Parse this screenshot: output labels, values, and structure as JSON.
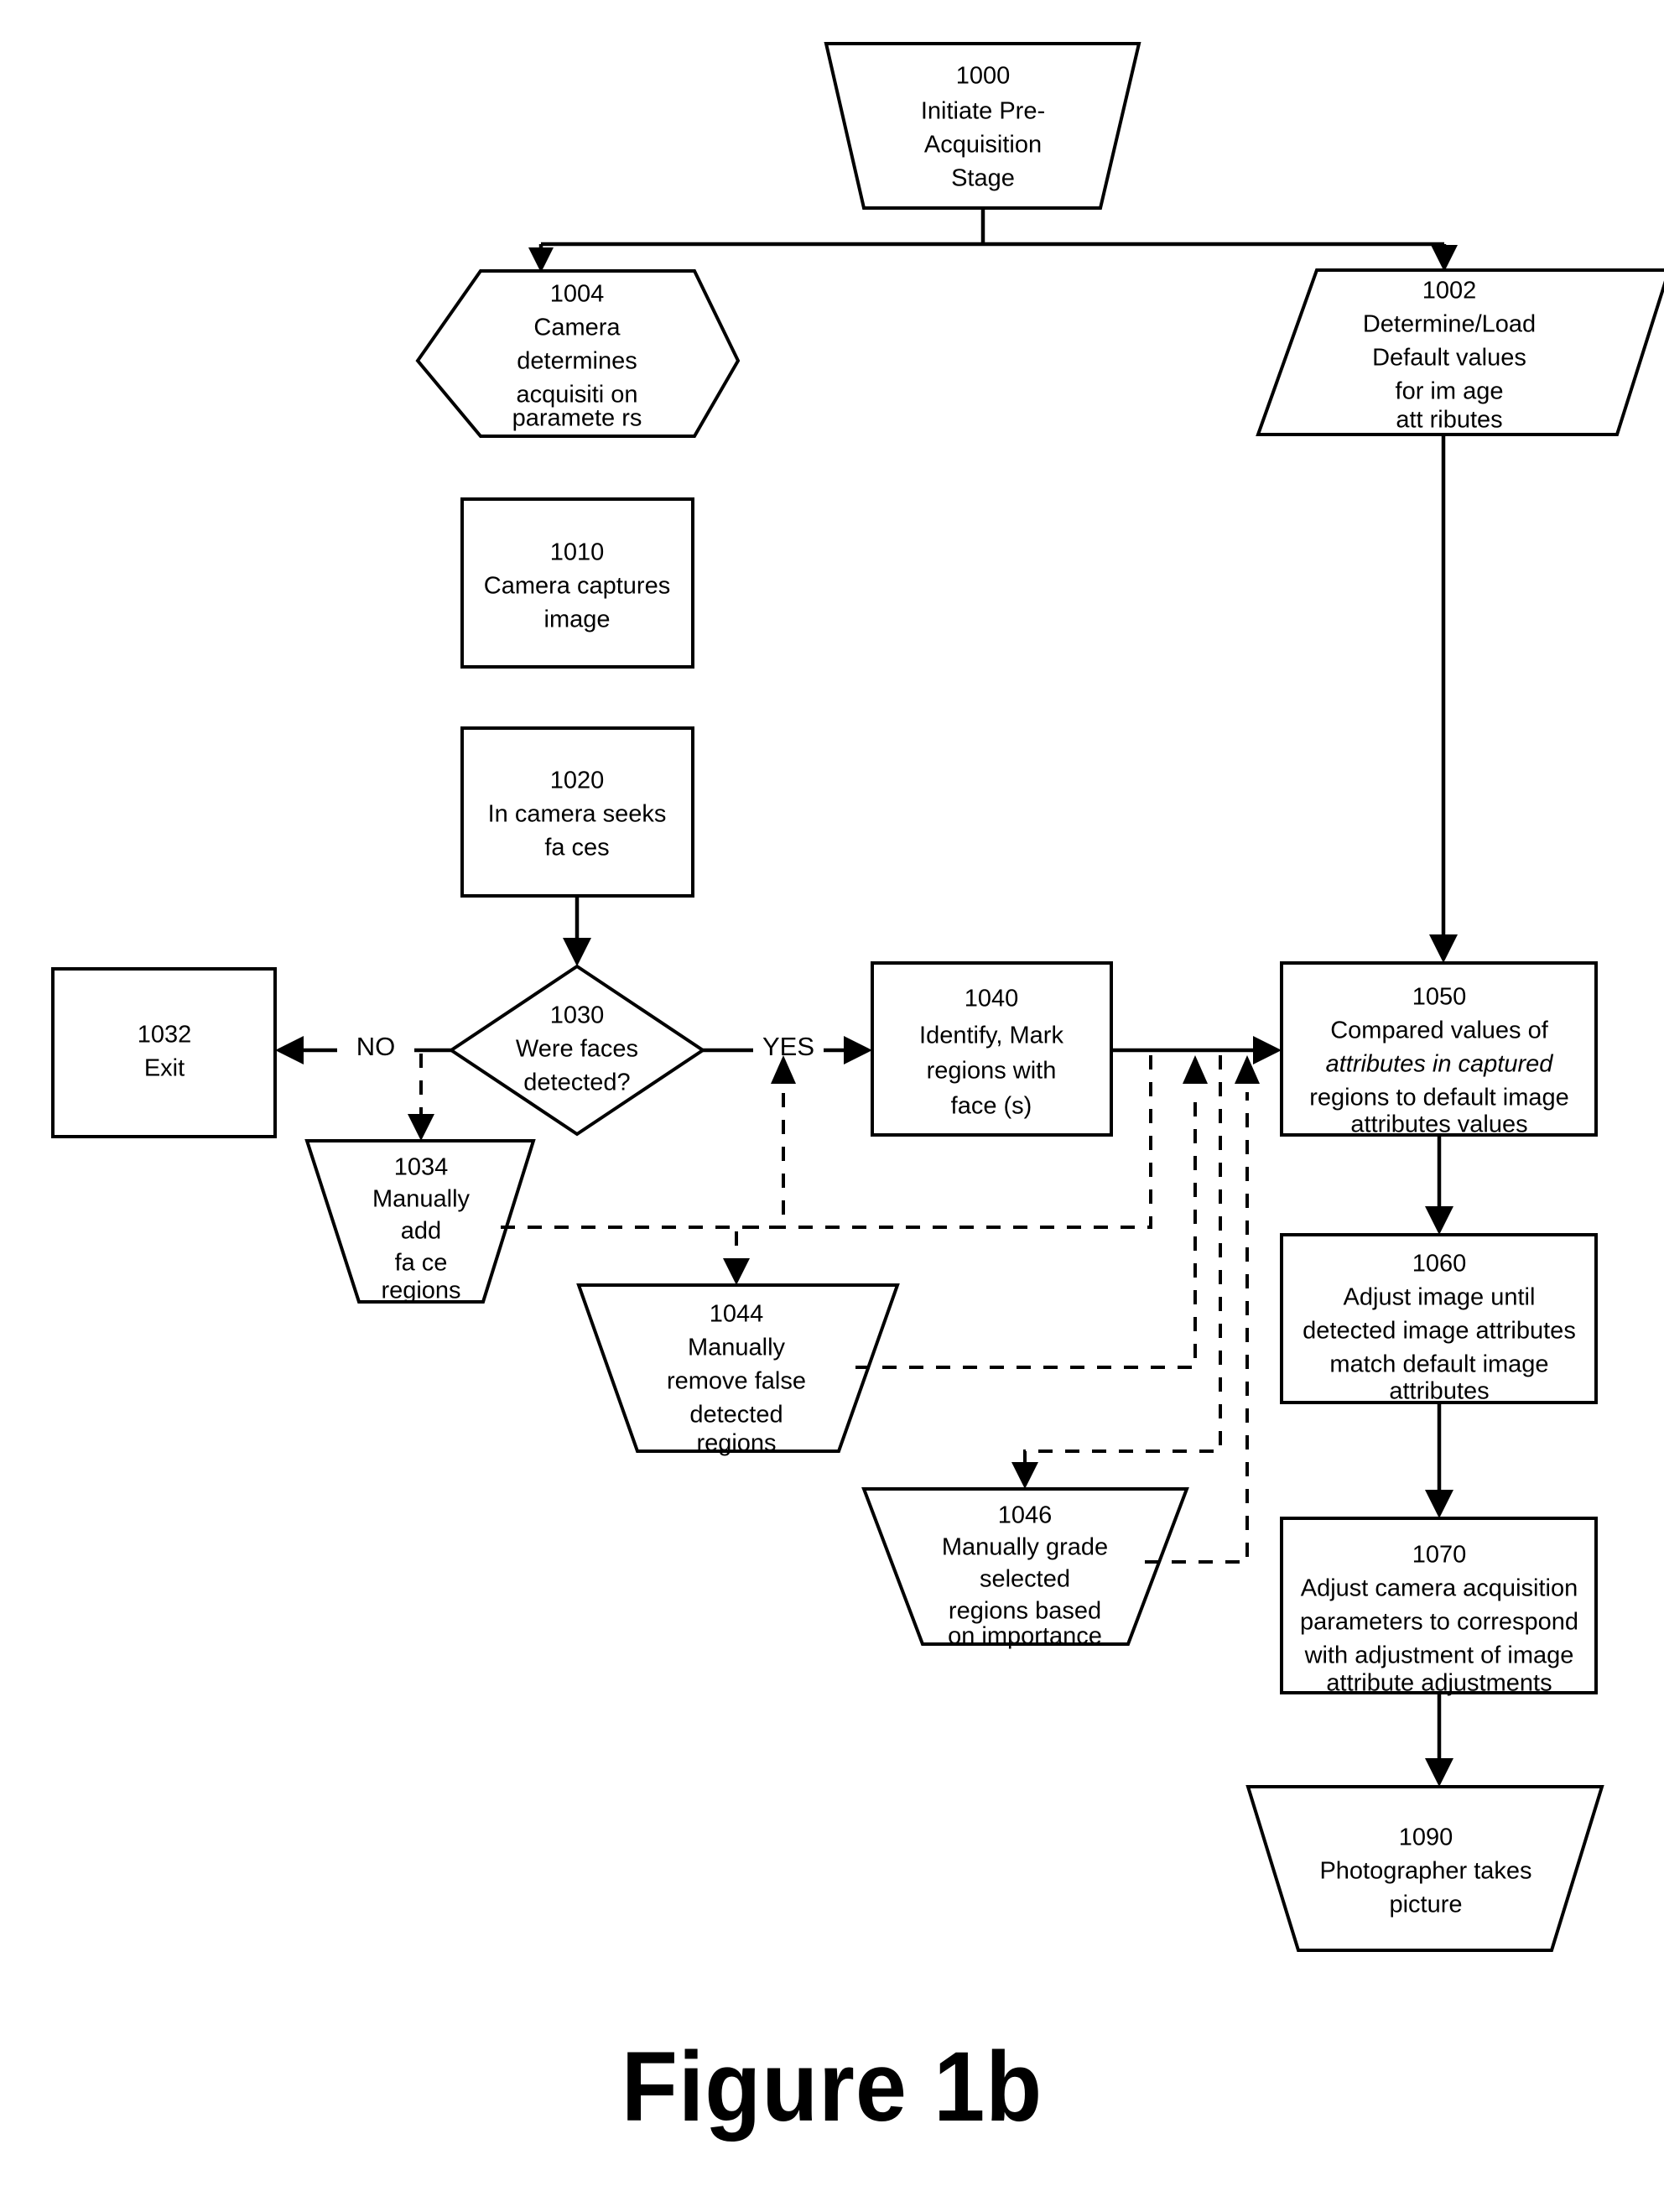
{
  "figure": {
    "caption": "Figure 1b"
  },
  "nodes": {
    "n1000": {
      "id": "1000",
      "shape": "trapezoid-down",
      "lines": [
        "1000",
        "Initiate Pre-",
        "Acquisition",
        "Stage"
      ]
    },
    "n1004": {
      "id": "1004",
      "shape": "hexagon",
      "lines": [
        "1004",
        "Camera",
        "determines",
        "acquisiti on",
        "paramete  rs"
      ]
    },
    "n1002": {
      "id": "1002",
      "shape": "parallelogram",
      "lines": [
        "1002",
        "Determine/Load",
        "Default values",
        "for  im age",
        "att ributes"
      ]
    },
    "n1010": {
      "id": "1010",
      "shape": "rect",
      "lines": [
        "1010",
        "Camera captures",
        "image"
      ]
    },
    "n1020": {
      "id": "1020",
      "shape": "rect",
      "lines": [
        "1020",
        "In camera seeks",
        "fa ces"
      ]
    },
    "n1030": {
      "id": "1030",
      "shape": "diamond",
      "lines": [
        "1030",
        "Were faces",
        "detected?"
      ]
    },
    "n1032": {
      "id": "1032",
      "shape": "rect",
      "lines": [
        "1032",
        "Exit"
      ]
    },
    "n1034": {
      "id": "1034",
      "shape": "trapezoid-down",
      "lines": [
        "1034",
        "Manually",
        "add",
        "fa ce",
        "regions"
      ]
    },
    "n1040": {
      "id": "1040",
      "shape": "rect",
      "lines": [
        "1040",
        "Identify, Mark",
        "regions with",
        "face (s)"
      ]
    },
    "n1044": {
      "id": "1044",
      "shape": "trapezoid-down",
      "lines": [
        "1044",
        "Manually",
        "remove false",
        "detected",
        "regions"
      ]
    },
    "n1046": {
      "id": "1046",
      "shape": "trapezoid-down",
      "lines": [
        "1046",
        "Manually grade",
        "selected",
        "regions based",
        "on importance"
      ]
    },
    "n1050": {
      "id": "1050",
      "shape": "rect",
      "lines": [
        "1050",
        "Compared values of",
        "attributes in captured",
        "regions to default image",
        "attributes values"
      ],
      "italic_lines": [
        2
      ]
    },
    "n1060": {
      "id": "1060",
      "shape": "rect",
      "lines": [
        "1060",
        "Adjust image until",
        "detected image attributes",
        "match  default image",
        "attributes"
      ]
    },
    "n1070": {
      "id": "1070",
      "shape": "rect",
      "lines": [
        "1070",
        "Adjust camera acquisition",
        "parameters to correspond",
        "with  adjustment of image",
        "attribute adjustments"
      ]
    },
    "n1090": {
      "id": "1090",
      "shape": "trapezoid-down",
      "lines": [
        "1090",
        "Photographer takes",
        "picture"
      ]
    }
  },
  "edge_labels": {
    "no": "NO",
    "yes": "YES"
  },
  "colors": {
    "line": "#000000",
    "fill": "#ffffff",
    "background": "#ffffff"
  }
}
